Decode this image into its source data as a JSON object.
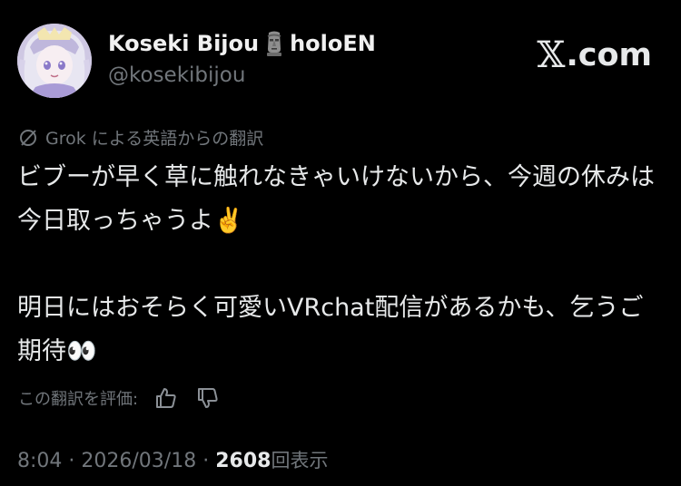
{
  "author": {
    "display_name": "Koseki Bijou",
    "name_suffix": "holoEN",
    "name_emoji": "moai-icon",
    "handle": "@kosekibijou",
    "avatar": "avatar"
  },
  "brand": {
    "x_mark": "𝕏",
    "domain": ".com"
  },
  "translation": {
    "icon": "grok-icon",
    "label": "Grok による英語からの翻訳"
  },
  "tweet": {
    "text": "ビブーが早く草に触れなきゃいけないから、今週の休みは今日取っちゃうよ✌️\n\n明日にはおそらく可愛いVRchat配信があるかも、乞うご期待👀"
  },
  "rating": {
    "label": "この翻訳を評価:",
    "like_icon": "thumbs-up-icon",
    "dislike_icon": "thumbs-down-icon"
  },
  "meta": {
    "time": "8:04",
    "separator": "·",
    "date": "2026/03/18",
    "views": "2608",
    "views_label": "回表示"
  },
  "colors": {
    "background": "#000000",
    "text_primary": "#e7e9ea",
    "text_secondary": "#71767b"
  }
}
